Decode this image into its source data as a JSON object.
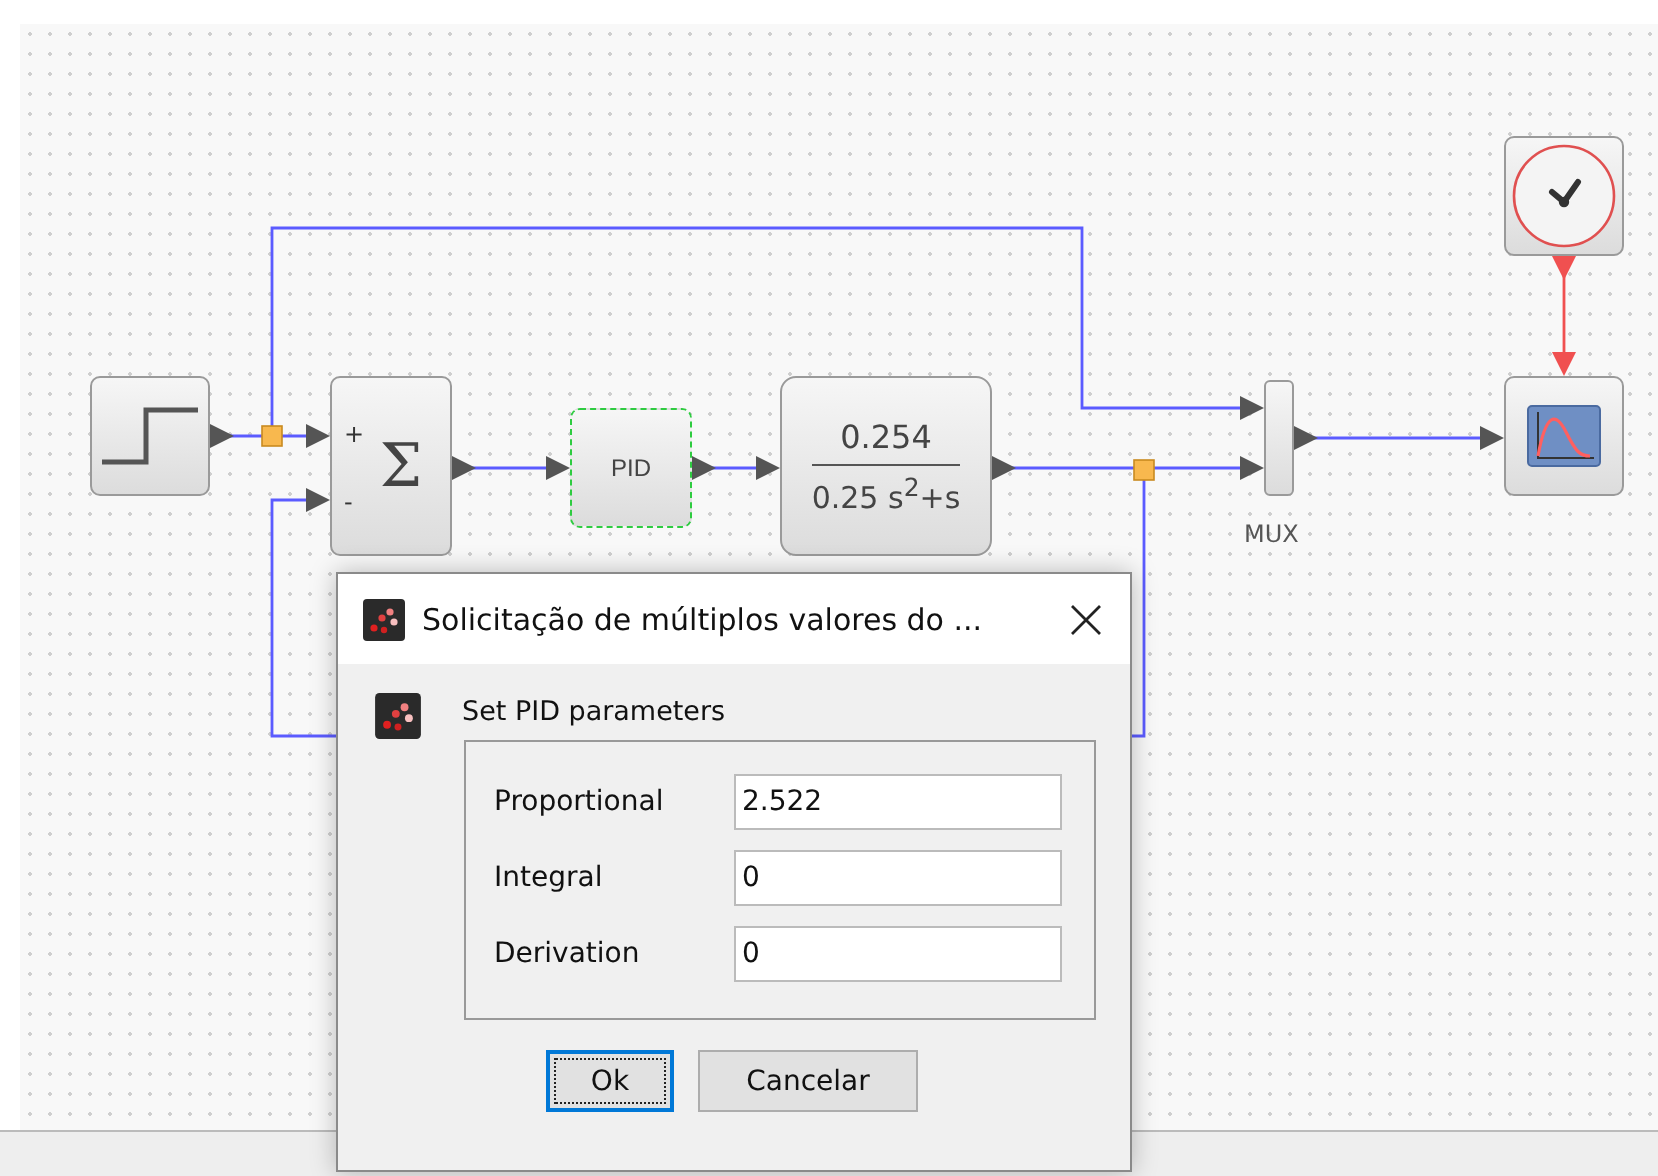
{
  "diagram": {
    "blocks": [
      {
        "kind": "step",
        "selected": false
      },
      {
        "kind": "sum",
        "selected": false,
        "signs": [
          "+",
          "-"
        ],
        "symbol": "Σ"
      },
      {
        "kind": "text",
        "selected": true,
        "label": "PID"
      },
      {
        "kind": "fraction",
        "selected": false,
        "numerator": "0.254",
        "denominator": "0.25 s$^{2}$+s"
      },
      {
        "kind": "mux",
        "selected": false,
        "label": "MUX"
      },
      {
        "kind": "scope",
        "selected": false
      },
      {
        "kind": "clock",
        "selected": false
      }
    ]
  },
  "dialog": {
    "title": "Solicitação de múltiplos valores do ...",
    "heading": "Set PID parameters",
    "fields": [
      {
        "label": "Proportional",
        "value": "2.522"
      },
      {
        "label": "Integral",
        "value": "0"
      },
      {
        "label": "Derivation",
        "value": "0"
      }
    ],
    "buttons": [
      {
        "label": "Ok",
        "focused": true
      },
      {
        "label": "Cancelar",
        "focused": false
      }
    ]
  }
}
